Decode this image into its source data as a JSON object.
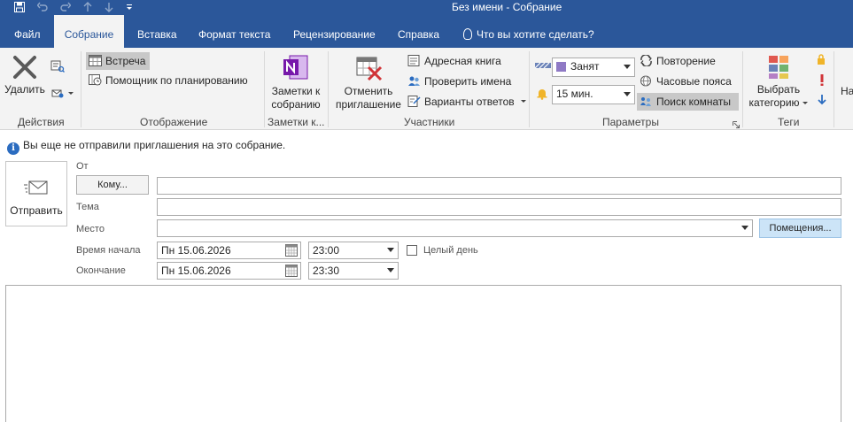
{
  "window": {
    "title": "Без имени  -  Собрание"
  },
  "qat": {
    "save_icon": "save-icon",
    "undo_icon": "undo-icon",
    "redo_icon": "redo-icon",
    "up_icon": "arrow-up-icon",
    "down_icon": "arrow-down-icon",
    "customize_icon": "customize-icon"
  },
  "tabs": {
    "file": "Файл",
    "meeting": "Собрание",
    "insert": "Вставка",
    "format": "Формат текста",
    "review": "Рецензирование",
    "help": "Справка",
    "tell_me": "Что вы хотите сделать?"
  },
  "ribbon": {
    "actions": {
      "label": "Действия",
      "delete": "Удалить"
    },
    "show": {
      "label": "Отображение",
      "appointment": "Встреча",
      "scheduling": "Помощник по планированию"
    },
    "notes": {
      "label": "Заметки к...",
      "line1": "Заметки к",
      "line2": "собранию"
    },
    "attendees": {
      "label": "Участники",
      "cancel_line1": "Отменить",
      "cancel_line2": "приглашение",
      "address_book": "Адресная книга",
      "check_names": "Проверить имена",
      "response_options": "Варианты ответов"
    },
    "options": {
      "label": "Параметры",
      "show_as": "Занят",
      "reminder": "15 мин.",
      "recurrence": "Повторение",
      "time_zones": "Часовые пояса",
      "room_finder": "Поиск комнаты"
    },
    "tags": {
      "label": "Теги",
      "categorize_line1": "Выбрать",
      "categorize_line2": "категорию"
    },
    "overflow": "На"
  },
  "info_bar": "Вы еще не отправили приглашения на это собрание.",
  "form": {
    "send": "Отправить",
    "from_label": "От",
    "to_button": "Кому...",
    "to_value": "",
    "subject_label": "Тема",
    "subject_value": "",
    "location_label": "Место",
    "location_value": "",
    "rooms_button": "Помещения...",
    "start_label": "Время начала",
    "start_date": "Пн 15.06.2026",
    "start_time": "23:00",
    "all_day": "Целый день",
    "end_label": "Окончание",
    "end_date": "Пн 15.06.2026",
    "end_time": "23:30"
  },
  "colors": {
    "accent": "#2b579a",
    "ribbon_bg": "#f3f3f3",
    "rooms_button": "#cce4f7",
    "show_as_swatch": "#8f7ac5"
  }
}
